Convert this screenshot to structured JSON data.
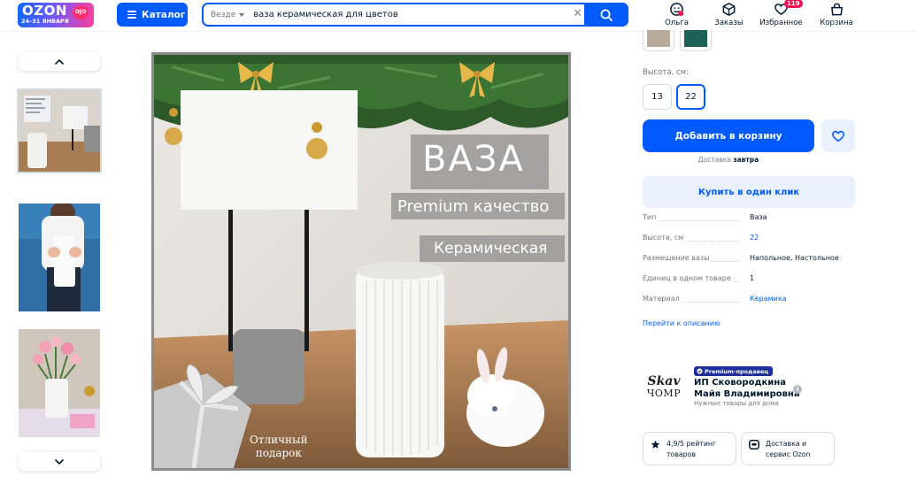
{
  "header": {
    "logo": {
      "brand": "OZON",
      "dates": "24–31 ЯНВАРЯ",
      "bubble": "OJO"
    },
    "catalog_label": "Каталог",
    "search": {
      "scope": "Везде",
      "value": "ваза керамическая для цветов"
    },
    "nav": [
      {
        "id": "profile",
        "label": "Ольга",
        "icon": "smile-profile-icon"
      },
      {
        "id": "orders",
        "label": "Заказы",
        "icon": "box-icon"
      },
      {
        "id": "favorites",
        "label": "Избранное",
        "icon": "heart-icon",
        "badge": "119"
      },
      {
        "id": "cart",
        "label": "Корзина",
        "icon": "bag-icon"
      }
    ]
  },
  "gallery": {
    "main_image": {
      "title": "ВАЗА",
      "subtitle1": "Premium качество",
      "subtitle2": "Керамическая",
      "gift_text_1": "Отличный",
      "gift_text_2": "подарок"
    },
    "thumbs": [
      {
        "id": "thumb-1",
        "desc": "ваза на столе с лампой",
        "label_top": "Premium",
        "active": true
      },
      {
        "id": "thumb-2",
        "desc": "ваза в руках"
      },
      {
        "id": "thumb-3",
        "desc": "ваза с тюльпанами"
      }
    ]
  },
  "product": {
    "colors": [
      "#b9ab9c",
      "#1c6256"
    ],
    "height_label": "Высота, см:",
    "heights": [
      {
        "value": "13",
        "selected": false
      },
      {
        "value": "22",
        "selected": true
      }
    ],
    "add_to_cart": "Добавить в корзину",
    "delivery_prefix": "Доставка",
    "delivery_when": "завтра",
    "buy_one_click": "Купить в один клик",
    "specs": [
      {
        "key": "Тип",
        "value": "Ваза",
        "link": false
      },
      {
        "key": "Высота, см",
        "value": "22",
        "link": true
      },
      {
        "key": "Размещение вазы",
        "value": "Напольное, Настольное",
        "link": false
      },
      {
        "key": "Единиц в одном товаре",
        "value": "1",
        "link": false
      },
      {
        "key": "Материал",
        "value": "Керамика",
        "link": true
      }
    ],
    "goto_description": "Перейти к описанию"
  },
  "seller": {
    "logo_line1": "Skav",
    "logo_line2": "ЧОМР",
    "badge": "Premium-продавец",
    "name_line1": "ИП Сковородкина",
    "name_line2": "Майя Владимировна",
    "subtitle": "Нужные товары для дома",
    "rating_card": {
      "line1": "4,9/5 рейтинг",
      "line2": "товаров"
    },
    "delivery_card": {
      "line1": "Доставка и",
      "line2": "сервис Ozon"
    }
  },
  "colors": {
    "accent": "#005bff",
    "accent_light": "#e9f0ff",
    "badge_pink": "#f91155",
    "premium_badge": "#1d2f9c"
  }
}
